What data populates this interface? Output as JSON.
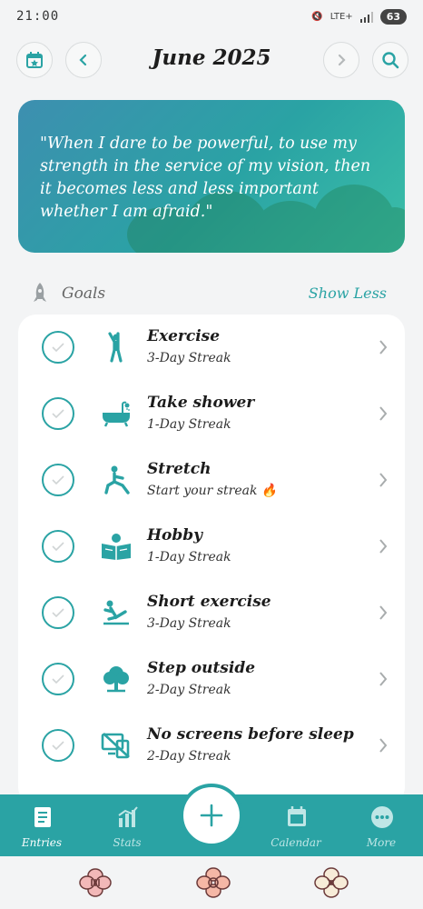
{
  "status": {
    "time": "21:00",
    "network": "LTE+",
    "battery": "63"
  },
  "header": {
    "title": "June 2025"
  },
  "quote": {
    "text": "\"When I dare to be powerful, to use my strength in the service of my vision, then it becomes less and less important whether I am afraid.\""
  },
  "goals_section": {
    "label": "Goals",
    "toggle_label": "Show Less"
  },
  "goals": [
    {
      "name": "Exercise",
      "streak": "3-Day Streak",
      "icon": "person-stretch-icon"
    },
    {
      "name": "Take shower",
      "streak": "1-Day Streak",
      "icon": "bathtub-icon"
    },
    {
      "name": "Stretch",
      "streak": "Start your streak 🔥",
      "icon": "lunge-icon"
    },
    {
      "name": "Hobby",
      "streak": "1-Day Streak",
      "icon": "reading-icon"
    },
    {
      "name": "Short exercise",
      "streak": "3-Day Streak",
      "icon": "sit-up-icon"
    },
    {
      "name": "Step outside",
      "streak": "2-Day Streak",
      "icon": "tree-icon"
    },
    {
      "name": "No screens before sleep",
      "streak": "2-Day Streak",
      "icon": "no-screen-icon"
    }
  ],
  "nav": {
    "entries": "Entries",
    "stats": "Stats",
    "calendar": "Calendar",
    "more": "More"
  },
  "colors": {
    "accent": "#2aa3a4",
    "nav_inactive": "#bfe6e6"
  }
}
